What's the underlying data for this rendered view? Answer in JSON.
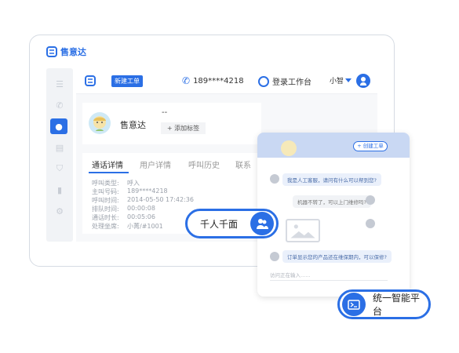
{
  "brand": {
    "name": "售意达",
    "color": "#2b6fe5"
  },
  "sidebar": {
    "items": [
      "menu-icon",
      "phone-icon",
      "user-icon",
      "clipboard-icon",
      "shield-icon",
      "chart-icon",
      "gear-icon"
    ],
    "active": "user-icon"
  },
  "topbar": {
    "new_ticket": "新建工单",
    "phone": "189****4218",
    "login": "登录工作台",
    "user": "小智"
  },
  "customer": {
    "name": "售意达",
    "value": "--",
    "add_tag": "+ 添加标签"
  },
  "tabs": [
    {
      "label": "通话详情",
      "active": true
    },
    {
      "label": "用户详情",
      "active": false
    },
    {
      "label": "呼叫历史",
      "active": false
    },
    {
      "label": "联系",
      "active": false
    }
  ],
  "call_detail": [
    {
      "label": "呼叫类型:",
      "value": "呼入"
    },
    {
      "label": "主叫号码:",
      "value": "189****4218"
    },
    {
      "label": "呼叫时间:",
      "value": "2014-05-50 17:42:36"
    },
    {
      "label": "排队时间:",
      "value": "00:00:08"
    },
    {
      "label": "通话时长:",
      "value": "00:05:06"
    },
    {
      "label": "处理坐席:",
      "value": "小菁/#1001"
    }
  ],
  "chat": {
    "create_ticket": "+ 创建工单",
    "messages": [
      {
        "from": "agent",
        "text": "我是人工客服，请问有什么可以帮到您?"
      },
      {
        "from": "user",
        "text": "机器不转了，可以上门维修吗?"
      },
      {
        "from": "agent",
        "text": "订单显示您的产品还在维保期内，可以保修?"
      }
    ],
    "input_placeholder": "访问正在输入......"
  },
  "badges": {
    "badge1": "千人千面",
    "badge2": "统一智能平台"
  }
}
